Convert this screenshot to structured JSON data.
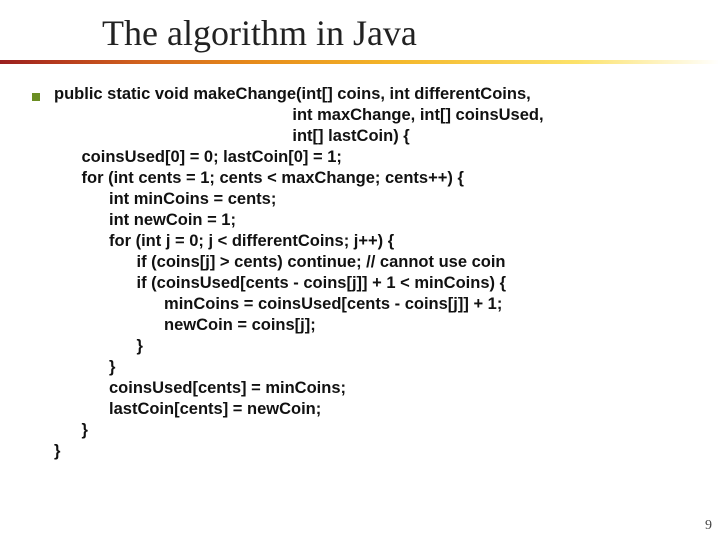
{
  "title": "The algorithm in Java",
  "pageNumber": "9",
  "code": {
    "l01": "public static void makeChange(int[] coins, int differentCoins,",
    "l02": "                                                    int maxChange, int[] coinsUsed,",
    "l03": "                                                    int[] lastCoin) {",
    "l04": "      coinsUsed[0] = 0; lastCoin[0] = 1;",
    "l05": "      for (int cents = 1; cents < maxChange; cents++) {",
    "l06": "            int minCoins = cents;",
    "l07": "            int newCoin = 1;",
    "l08": "            for (int j = 0; j < differentCoins; j++) {",
    "l09": "                  if (coins[j] > cents) continue; // cannot use coin",
    "l10": "                  if (coinsUsed[cents - coins[j]] + 1 < minCoins) {",
    "l11": "                        minCoins = coinsUsed[cents - coins[j]] + 1;",
    "l12": "                        newCoin = coins[j];",
    "l13": "                  }",
    "l14": "            }",
    "l15": "            coinsUsed[cents] = minCoins;",
    "l16": "            lastCoin[cents] = newCoin;",
    "l17": "      }",
    "l18": "}"
  }
}
